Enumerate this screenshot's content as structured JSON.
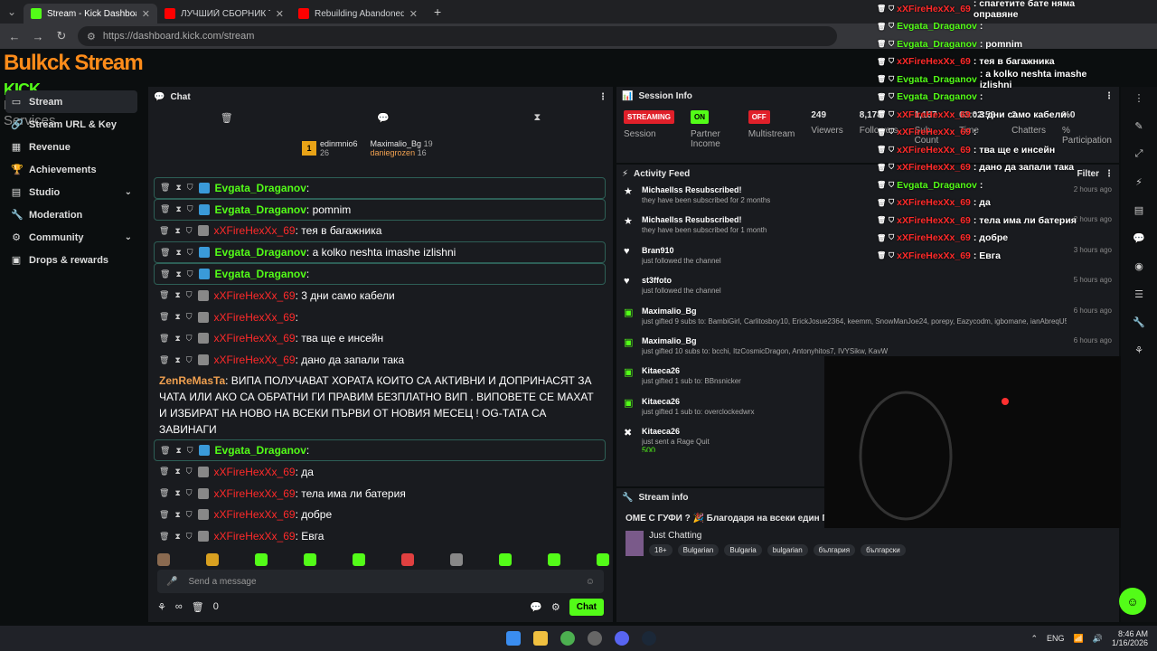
{
  "browser": {
    "tabs": [
      {
        "title": "Stream - Kick Dashboard"
      },
      {
        "title": "ЛУЧШИЙ СБОРНИК ТРЕКОВ"
      },
      {
        "title": "Rebuilding Abandoned Compo"
      }
    ],
    "new_tab": "+",
    "url": "https://dashboard.kick.com/stream"
  },
  "logo": {
    "line1": "Bulkck Stream",
    "line1b": "KICK",
    "line2": "Live Webcasting Services"
  },
  "sidebar": {
    "items": [
      {
        "label": "Stream",
        "icon": "▭"
      },
      {
        "label": "Stream URL & Key",
        "icon": "🔗"
      },
      {
        "label": "Revenue",
        "icon": "▦"
      },
      {
        "label": "Achievements",
        "icon": "🏆"
      },
      {
        "label": "Studio",
        "icon": "▤",
        "chev": "⌄"
      },
      {
        "label": "Moderation",
        "icon": "🔧"
      },
      {
        "label": "Community",
        "icon": "⚙",
        "chev": "⌄"
      },
      {
        "label": "Drops & rewards",
        "icon": "▣"
      }
    ]
  },
  "chat": {
    "title": "Chat",
    "pinned": [
      {
        "rank": "1",
        "name": "edinmnio6",
        "count": "26"
      },
      {
        "name": "Maximalio_Bg",
        "count": "19"
      },
      {
        "name": "daniegrozen",
        "count": "16"
      }
    ],
    "messages": [
      {
        "user": "Evgata_Draganov",
        "text": ":",
        "cls": "u1",
        "hl": true
      },
      {
        "user": "Evgata_Draganov",
        "text": ": pomnim",
        "cls": "u1",
        "hl": true
      },
      {
        "user": "xXFireHexXx_69",
        "text": ": тея в багажника",
        "cls": "u2",
        "hl": false
      },
      {
        "user": "Evgata_Draganov",
        "text": ": a kolko neshta imashe izlishni",
        "cls": "u1",
        "hl": true
      },
      {
        "user": "Evgata_Draganov",
        "text": ":",
        "cls": "u1",
        "hl": true
      },
      {
        "user": "xXFireHexXx_69",
        "text": ": 3 дни само кабели",
        "cls": "u2",
        "hl": false
      },
      {
        "user": "xXFireHexXx_69",
        "text": ":",
        "cls": "u2",
        "hl": false
      },
      {
        "user": "xXFireHexXx_69",
        "text": ": тва ще е инсейн",
        "cls": "u2",
        "hl": false
      },
      {
        "user": "xXFireHexXx_69",
        "text": ": дано да запали така",
        "cls": "u2",
        "hl": false
      }
    ],
    "long_msg": {
      "user": "ZenReMasTa",
      "text": ": ВИПА ПОЛУЧАВАТ ХОРАТА КОИТО СА АКТИВНИ И ДОПРИНАСЯТ ЗА ЧАТА ИЛИ АКО СА ОБРАТНИ ГИ ПРАВИМ БЕЗПЛАТНО ВИП . ВИПОВЕТЕ СЕ МАХАТ И ИЗБИРАТ НА НОВО НА ВСЕКИ ПЪРВИ ОТ НОВИЯ МЕСЕЦ ! OG-ТАТА СА ЗАВИНАГИ"
    },
    "messages2": [
      {
        "user": "Evgata_Draganov",
        "text": ":",
        "cls": "u1",
        "hl": true
      },
      {
        "user": "xXFireHexXx_69",
        "text": ": да",
        "cls": "u2",
        "hl": false
      },
      {
        "user": "xXFireHexXx_69",
        "text": ": тела има ли батерия",
        "cls": "u2",
        "hl": false
      },
      {
        "user": "xXFireHexXx_69",
        "text": ": добре",
        "cls": "u2",
        "hl": false
      },
      {
        "user": "xXFireHexXx_69",
        "text": ": Евга",
        "cls": "u2",
        "hl": false
      }
    ],
    "placeholder": "Send a message",
    "viewers_count": "0",
    "chat_button": "Chat",
    "infinity": "∞"
  },
  "session": {
    "title": "Session Info",
    "stats": [
      {
        "pill": "STREAMING",
        "label": "Session",
        "color": "#e0202a"
      },
      {
        "pill": "ON",
        "label": "Partner Income",
        "color": "#53fc18"
      },
      {
        "pill": "OFF",
        "label": "Multistream",
        "color": "#e0202a"
      },
      {
        "value": "249",
        "label": "Viewers"
      },
      {
        "value": "8,178",
        "label": "Followers"
      },
      {
        "value": "1,107",
        "label": "Sub Count"
      },
      {
        "value": "03:02:59",
        "label": "Time"
      },
      {
        "value": "2",
        "label": "Chatters"
      },
      {
        "value": "%0",
        "label": "% Participation"
      }
    ]
  },
  "activity": {
    "title": "Activity Feed",
    "filter": "Filter",
    "items": [
      {
        "icon": "★",
        "name": "Michaellss Resubscribed!",
        "desc": "they have been subscribed for 2 months",
        "time": "2 hours ago"
      },
      {
        "icon": "★",
        "name": "Michaellss Resubscribed!",
        "desc": "they have been subscribed for 1 month",
        "time": "2 hours ago"
      },
      {
        "icon": "♥",
        "name": "Bran910",
        "desc": "just followed the channel",
        "time": "3 hours ago"
      },
      {
        "icon": "♥",
        "name": "st3ffoto",
        "desc": "just followed the channel",
        "time": "5 hours ago"
      },
      {
        "icon": "▣",
        "name": "Maximalio_Bg",
        "desc": "just gifted 9 subs to: BambiGirl, Carlitosboy10, ErickJosue2364, keemm, SnowManJoe24, porepy, Eazycodm, igbomane, ianAbreqU5",
        "time": "6 hours ago"
      },
      {
        "icon": "▣",
        "name": "Maximalio_Bg",
        "desc": "just gifted 10 subs to: bcchi, ItzCosmicDragon, Antonyhitos7, IVYSikw, KavW",
        "time": "6 hours ago"
      },
      {
        "icon": "▣",
        "name": "Kitaeca26",
        "desc": "just gifted 1 sub to: BBnsnicker",
        "time": ""
      },
      {
        "icon": "▣",
        "name": "Kitaeca26",
        "desc": "just gifted 1 sub to: overclockedwrx",
        "time": ""
      },
      {
        "icon": "✖",
        "name": "Kitaeca26",
        "desc": "just sent a Rage Quit",
        "extra": "500",
        "time": ""
      }
    ]
  },
  "stream_info": {
    "title": "Stream info",
    "stream_title": "OME С ГУФИ ? 🎉 Благодаря на всеки един Гол",
    "category": "Just Chatting",
    "tags": [
      "18+",
      "Bulgarian",
      "Bulgaria",
      "bulgarian",
      "българия",
      "български"
    ]
  },
  "overlay": [
    {
      "user": "xXFireHexXx_69",
      "text": ": спагетите бате няма оправяне",
      "c": "n2"
    },
    {
      "user": "Evgata_Draganov",
      "text": ":",
      "c": "n1"
    },
    {
      "user": "Evgata_Draganov",
      "text": ": pomnim",
      "c": "n1"
    },
    {
      "user": "xXFireHexXx_69",
      "text": ": тея в багажника",
      "c": "n2"
    },
    {
      "user": "Evgata_Draganov",
      "text": ": a kolko neshta imashe izlishni",
      "c": "n1"
    },
    {
      "user": "Evgata_Draganov",
      "text": ":",
      "c": "n1"
    },
    {
      "user": "xXFireHexXx_69",
      "text": ": 3 дни само кабели",
      "c": "n2"
    },
    {
      "user": "xXFireHexXx_69",
      "text": ":",
      "c": "n2"
    },
    {
      "user": "xXFireHexXx_69",
      "text": ": тва ще е инсейн",
      "c": "n2"
    },
    {
      "user": "xXFireHexXx_69",
      "text": ": дано да запали така",
      "c": "n2"
    },
    {
      "user": "Evgata_Draganov",
      "text": ":",
      "c": "n1"
    },
    {
      "user": "xXFireHexXx_69",
      "text": ": да",
      "c": "n2"
    },
    {
      "user": "xXFireHexXx_69",
      "text": ": тела има ли батерия",
      "c": "n2"
    },
    {
      "user": "xXFireHexXx_69",
      "text": ": добре",
      "c": "n2"
    },
    {
      "user": "xXFireHexXx_69",
      "text": ": Евга",
      "c": "n2"
    }
  ],
  "taskbar": {
    "lang": "ENG",
    "time": "8:46 AM",
    "date": "1/16/2026"
  }
}
